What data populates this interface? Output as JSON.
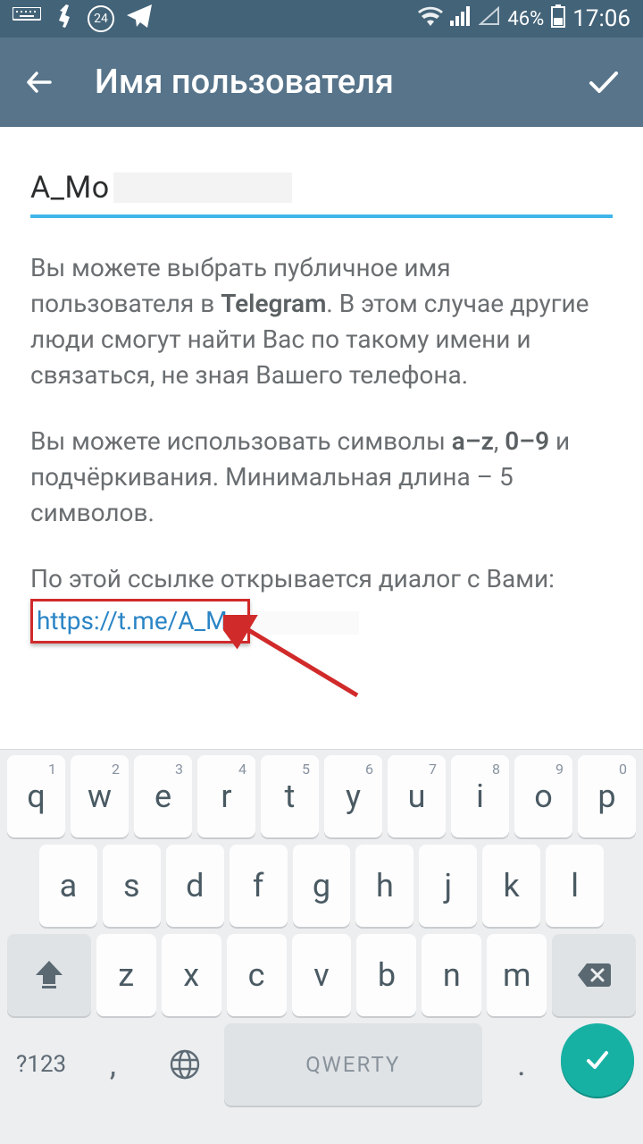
{
  "status": {
    "badge": "24",
    "battery_pct": "46%",
    "time": "17:06"
  },
  "appbar": {
    "title": "Имя пользователя"
  },
  "username": {
    "value": "A_Mo"
  },
  "desc": {
    "p1_a": "Вы можете выбрать публичное имя пользователя в ",
    "p1_bold": "Telegram",
    "p1_b": ". В этом случае другие люди смогут найти Вас по такому имени и связаться, не зная Вашего телефона.",
    "p2_a": "Вы можете использовать символы ",
    "p2_bold1": "a–z",
    "p2_mid": ", ",
    "p2_bold2": "0–9",
    "p2_b": " и подчёркивания. Минимальная длина – 5 символов.",
    "p3": "По этой ссылке открывается диалог с Вами:",
    "link": "https://t.me/A_Mo"
  },
  "keyboard": {
    "row1_sup": [
      "1",
      "2",
      "3",
      "4",
      "5",
      "6",
      "7",
      "8",
      "9",
      "0"
    ],
    "row1": [
      "q",
      "w",
      "e",
      "r",
      "t",
      "y",
      "u",
      "i",
      "o",
      "p"
    ],
    "row2": [
      "a",
      "s",
      "d",
      "f",
      "g",
      "h",
      "j",
      "k",
      "l"
    ],
    "row3": [
      "z",
      "x",
      "c",
      "v",
      "b",
      "n",
      "m"
    ],
    "sym": "?123",
    "space": "QWERTY",
    "comma": ",",
    "dot": "."
  }
}
